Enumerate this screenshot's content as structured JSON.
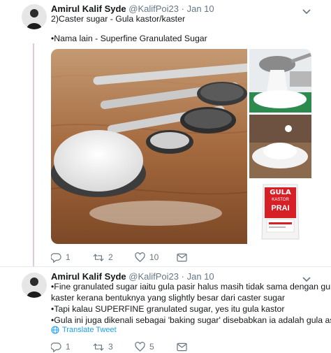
{
  "tweets": [
    {
      "name": "Amirul Kalif Syde",
      "handle": "@KalifPoi23",
      "separator": "·",
      "date": "Jan 10",
      "lines": [
        "2)Caster sugar - Gula kastor/kaster",
        "•Nama lain - Superfine Granulated Sugar"
      ],
      "actions": {
        "reply": "1",
        "retweet": "2",
        "like": "10"
      },
      "icons": [
        "reply-icon",
        "retweet-icon",
        "like-icon",
        "message-icon",
        "chevron-down-icon"
      ],
      "media_package_text": {
        "brand_top": "GULA",
        "brand_mid": "KASTOR",
        "brand_bottom": "PRAI"
      }
    },
    {
      "name": "Amirul Kalif Syde",
      "handle": "@KalifPoi23",
      "separator": "·",
      "date": "Jan 10",
      "lines": [
        "•Fine granulated sugar iaitu gula pasir halus masih tidak sama dengan gula",
        "kaster kerana bentuknya yang slightly besar dari caster sugar",
        "•Tapi kalau SUPERFINE granulated sugar, yes itu gula kastor",
        "•Gula ini juga dikenali sebagai 'baking sugar' disebabkan ia adalah gula asas"
      ],
      "translate": "Translate Tweet",
      "actions": {
        "reply": "1",
        "retweet": "3",
        "like": "5"
      },
      "icons": [
        "reply-icon",
        "retweet-icon",
        "like-icon",
        "message-icon",
        "globe-icon",
        "chevron-down-icon"
      ]
    }
  ],
  "colors": {
    "thread_line": "#e1c6e6",
    "link": "#1da1f2",
    "muted": "#657786",
    "text": "#14171a"
  }
}
